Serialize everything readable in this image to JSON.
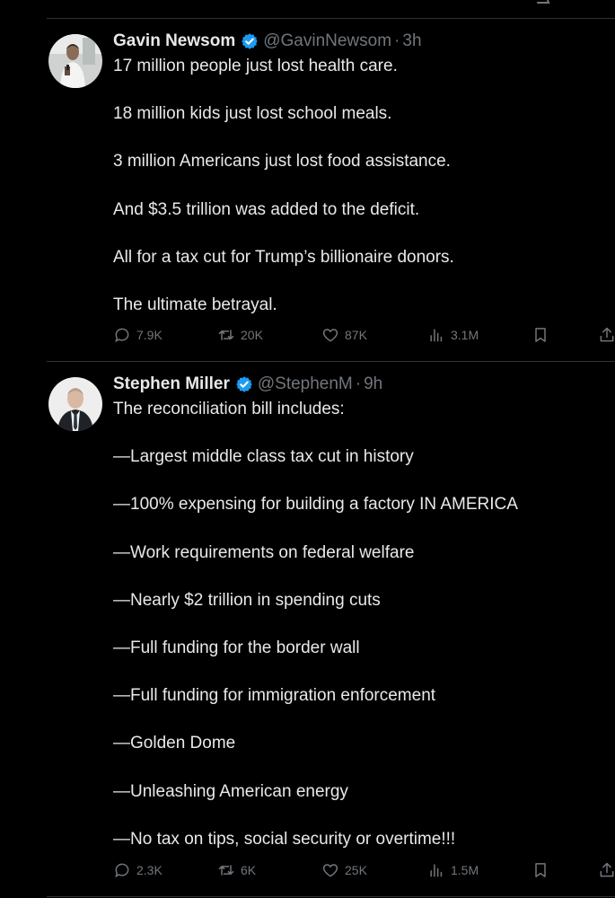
{
  "tweets": [
    {
      "name": "Gavin Newsom",
      "handle": "@GavinNewsom",
      "separator": "·",
      "time": "3h",
      "lines": [
        "17 million people just lost health care.",
        "",
        "18 million kids just lost school meals.",
        "",
        "3 million Americans just lost food assistance.",
        "",
        "And $3.5 trillion was added to the deficit.",
        "",
        "All for a tax cut for Trump’s billionaire donors.",
        "",
        "The ultimate betrayal."
      ],
      "stats": {
        "replies": "7.9K",
        "retweets": "20K",
        "likes": "87K",
        "views": "3.1M"
      }
    },
    {
      "name": "Stephen Miller",
      "handle": "@StephenM",
      "separator": "·",
      "time": "9h",
      "lines": [
        "The reconciliation bill includes:",
        "",
        "—Largest middle class tax cut in history",
        "",
        "—100% expensing for building a factory IN AMERICA",
        "",
        "—Work requirements on federal welfare",
        "",
        "—Nearly $2 trillion in spending cuts",
        "",
        "—Full funding for the border wall",
        "",
        "—Full funding for immigration enforcement",
        "",
        "—Golden Dome",
        "",
        "—Unleashing American energy",
        "",
        "—No tax on tips, social security or overtime!!!"
      ],
      "stats": {
        "replies": "2.3K",
        "retweets": "6K",
        "likes": "25K",
        "views": "1.5M"
      }
    }
  ],
  "colors": {
    "background": "#000000",
    "text": "#e7e9ea",
    "muted": "#71767b",
    "verified": "#1d9bf0",
    "divider": "#2f3336"
  },
  "icons": [
    "verified-badge-icon",
    "reply-icon",
    "retweet-icon",
    "like-icon",
    "views-icon",
    "bookmark-icon",
    "share-icon"
  ]
}
